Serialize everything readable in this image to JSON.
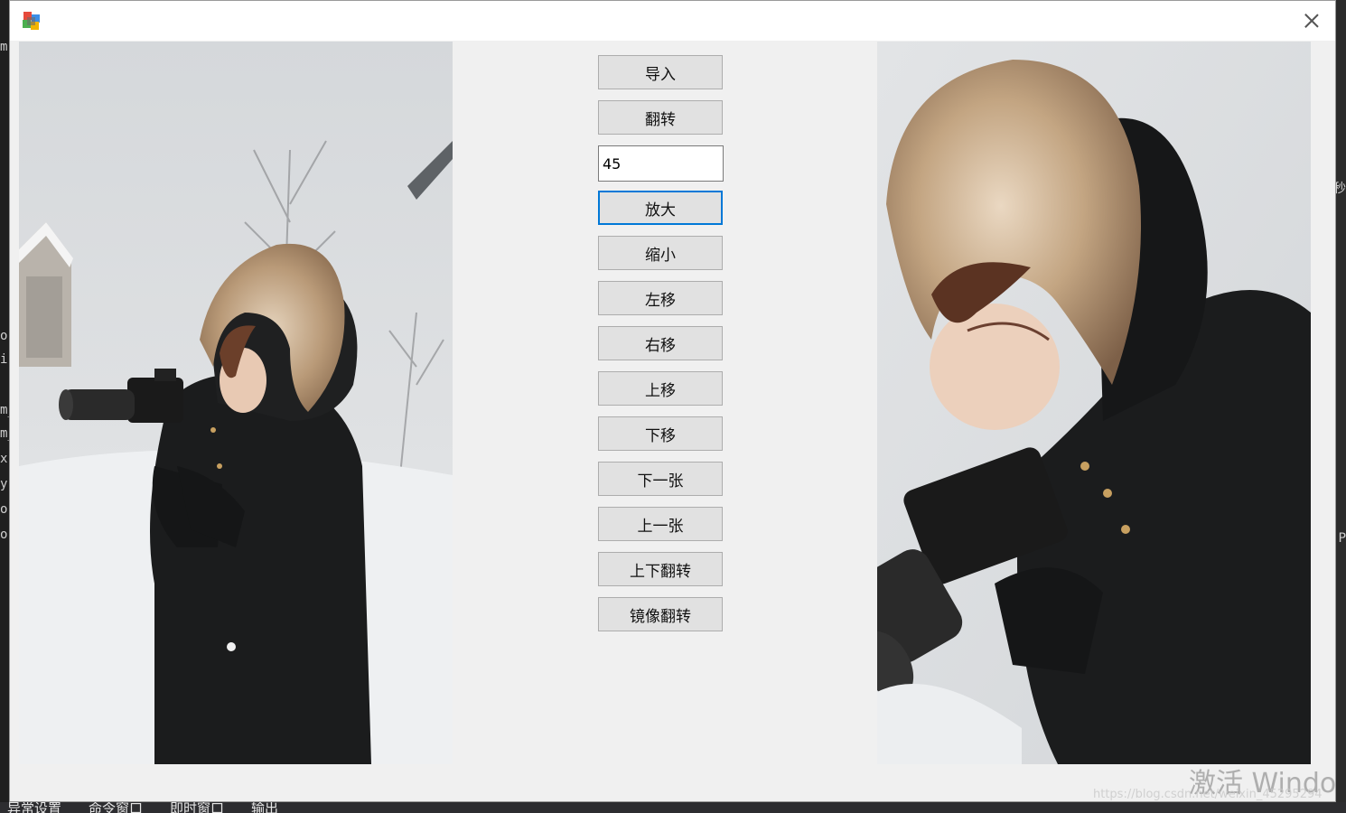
{
  "background": {
    "left_fragments": [
      "m",
      "o",
      "i",
      "m_",
      "m_",
      "x",
      "y",
      "o",
      "o"
    ],
    "right_fragments": [
      "秒",
      "P"
    ],
    "bottom_tabs": [
      "异常设置",
      "命令窗口",
      "即时窗口",
      "输出"
    ]
  },
  "window": {
    "icon": "app-cube-icon",
    "close_icon": "close-icon"
  },
  "left_image": {
    "subject": "photographer-in-snow"
  },
  "right_image": {
    "subject": "photographer-in-snow-zoomed"
  },
  "controls": {
    "import_label": "导入",
    "flip_label": "翻转",
    "angle_value": "45",
    "zoom_in_label": "放大",
    "zoom_out_label": "缩小",
    "move_left_label": "左移",
    "move_right_label": "右移",
    "move_up_label": "上移",
    "move_down_label": "下移",
    "next_label": "下一张",
    "prev_label": "上一张",
    "flip_vertical_label": "上下翻转",
    "mirror_label": "镜像翻转"
  },
  "overlay": {
    "activate_text": "激活 Windo",
    "url_text": "https://blog.csdn.net/weixin_45295294"
  },
  "colors": {
    "accent": "#0078d7",
    "window_bg": "#f0f0f0",
    "button_bg": "#e1e1e1"
  }
}
